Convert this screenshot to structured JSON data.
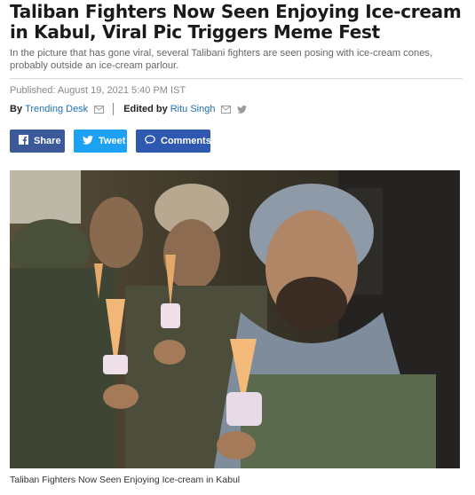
{
  "article": {
    "headline": "Taliban Fighters Now Seen Enjoying Ice-cream in Kabul, Viral Pic Triggers Meme Fest",
    "summary": "In the picture that has gone viral, several Talibani fighters are seen posing with ice-cream cones, probably outside an ice-cream parlour.",
    "published": "Published: August 19, 2021 5:40 PM IST",
    "byline": {
      "by_label": "By",
      "author": "Trending Desk",
      "edited_label": "Edited by",
      "editor": "Ritu Singh"
    },
    "caption": "Taliban Fighters Now Seen Enjoying Ice-cream in Kabul"
  },
  "share": {
    "facebook_label": "Share",
    "twitter_label": "Tweet",
    "comments_label": "Comments"
  },
  "colors": {
    "link": "#1f6fb2",
    "facebook": "#3b5998",
    "twitter": "#1da1f2",
    "comments": "#2f58b0"
  },
  "icons": [
    "mail-icon",
    "twitter-icon",
    "facebook-icon",
    "comment-icon"
  ]
}
